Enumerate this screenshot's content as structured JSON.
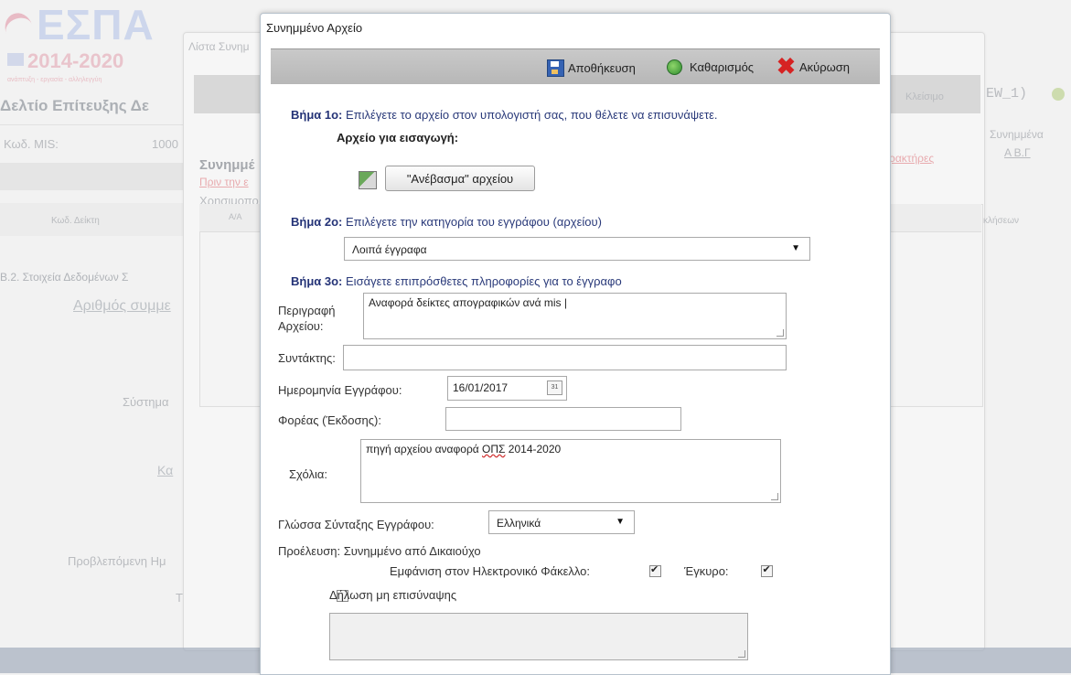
{
  "background": {
    "logo_word": "ΕΣΠΑ",
    "logo_years": "2014-2020",
    "logo_sub": "ανάπτυξη - εργασία - αλληλεγγύη",
    "page_title": "Δελτίο Επίτευξης Δε",
    "mis_label": "Κωδ. MIS:",
    "mis_value": "1000",
    "window_title": "Λίστα Συνημ",
    "section_title": "Συνημμέ",
    "red_link_left": "Πριν την ε",
    "red_link_right": "ρακτήρες",
    "helper_text": "Χρησιμοπο",
    "grid_col_aa": "Α/Α",
    "col_kod_deikti": "Κωδ. Δείκτη",
    "col_right": "κλήσεων",
    "section_b2": "Β.2. Στοιχεία Δεδομένων Σ",
    "arithmos": "Αριθμός συμμε",
    "systima": "Σύστημα",
    "ka": "Κα",
    "provlepomeni": "Προβλεπόμενη Ημ",
    "t_letter": "Τ",
    "right_code": "EW_1)",
    "right_close": "Κλείσιμο",
    "right_attached": "Συνημμένα",
    "right_codes": "Α  Β.Γ"
  },
  "dialog": {
    "title": "Συνημμένο Αρχείο",
    "toolbar": {
      "save": "Αποθήκευση",
      "clear": "Καθαρισμός",
      "cancel": "Ακύρωση"
    },
    "step1_label": "Βήμα 1ο:",
    "step1_text": "Επιλέγετε το αρχείο στον υπολογιστή σας, που θέλετε να επισυνάψετε.",
    "file_input_label": "Αρχείο για εισαγωγή:",
    "upload_button": "\"Ανέβασμα\" αρχείου",
    "step2_label": "Βήμα 2ο:",
    "step2_text": "Επιλέγετε την κατηγορία του εγγράφου (αρχείου)",
    "category_value": "Λοιπά έγγραφα",
    "step3_label": "Βήμα 3ο:",
    "step3_text": "Εισάγετε επιπρόσθετες πληροφορίες για το έγγραφο",
    "description_label_1": "Περιγραφή",
    "description_label_2": "Αρχείου:",
    "description_value": "Αναφορά δείκτες απογραφικών ανά mis |",
    "author_label": "Συντάκτης:",
    "author_value": "",
    "doc_date_label": "Ημερομηνία Εγγράφου:",
    "doc_date_value": "16/01/2017",
    "calendar_icon_text": "31",
    "issuer_label": "Φορέας (Έκδοσης):",
    "issuer_value": "",
    "comments_label": "Σχόλια:",
    "comments_prefix": "πηγή αρχείου  αναφορά ",
    "comments_misspelled": "ΟΠΣ",
    "comments_suffix": " 2014-2020",
    "language_label": "Γλώσσα Σύνταξης Εγγράφου:",
    "language_value": "Ελληνικά",
    "origin_text": "Προέλευση: Συνημμένο από Δικαιούχο",
    "show_in_folder_label": "Εμφάνιση στον Ηλεκτρονικό Φάκελλο:",
    "show_in_folder_checked": true,
    "valid_label": "Έγκυρο:",
    "valid_checked": true,
    "no_attach_label": "Δήλωση μη επισύναψης",
    "no_attach_checked": false,
    "no_attach_reason": ""
  },
  "colors": {
    "step_label": "#243377",
    "cancel_x": "#d62222",
    "toolbar_bg": "#bdbdbd"
  }
}
